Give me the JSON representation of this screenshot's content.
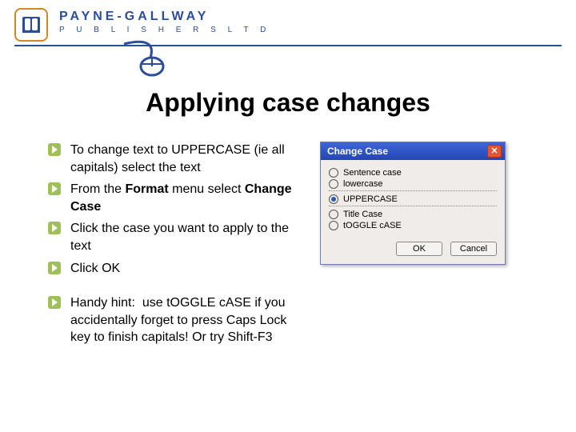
{
  "brand": {
    "name": "PAYNE-GALLWAY",
    "subtitle": "P U B L I S H E R S  L T D"
  },
  "title": "Applying case changes",
  "bullets": [
    "To change text to UPPERCASE (ie all capitals) select the text",
    "From the Format menu select Change Case",
    "Click the case you want to apply to the text",
    "Click OK",
    "Handy hint:  use tOGGLE cASE if you accidentally forget to press Caps Lock key to finish capitals! Or try Shift-F3"
  ],
  "bullets_html": [
    "To change text to UPPERCASE (ie all capitals) select the text",
    "From the <b>Format</b> menu select <b>Change Case</b>",
    "Click the case you want to apply to the text",
    "Click OK",
    "Handy hint:&nbsp; use tOGGLE cASE if you accidentally forget to press Caps Lock key to finish capitals! Or try Shift-F3"
  ],
  "dialog": {
    "title": "Change Case",
    "options": [
      {
        "label": "Sentence case",
        "selected": false
      },
      {
        "label": "lowercase",
        "selected": false
      },
      {
        "label": "UPPERCASE",
        "selected": true
      },
      {
        "label": "Title Case",
        "selected": false
      },
      {
        "label": "tOGGLE cASE",
        "selected": false
      }
    ],
    "buttons": {
      "ok": "OK",
      "cancel": "Cancel"
    }
  }
}
